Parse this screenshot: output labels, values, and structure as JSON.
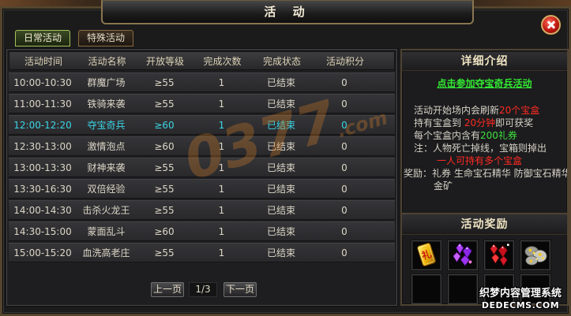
{
  "window": {
    "title": "活 动"
  },
  "tabs": [
    {
      "label": "日常活动",
      "active": true
    },
    {
      "label": "特殊活动",
      "active": false
    }
  ],
  "table": {
    "columns": [
      "活动时间",
      "活动名称",
      "开放等级",
      "完成次数",
      "完成状态",
      "活动积分"
    ],
    "rows": [
      {
        "time": "10:00-10:30",
        "name": "群魔广场",
        "level": "≥55",
        "count": "1",
        "status": "已结束",
        "points": "0"
      },
      {
        "time": "11:00-11:30",
        "name": "铁骑来袭",
        "level": "≥55",
        "count": "1",
        "status": "已结束",
        "points": "0"
      },
      {
        "time": "12:00-12:20",
        "name": "夺宝奇兵",
        "level": "≥60",
        "count": "1",
        "status": "已结束",
        "points": "0",
        "selected": true
      },
      {
        "time": "12:30-13:00",
        "name": "激情泡点",
        "level": "≥60",
        "count": "1",
        "status": "已结束",
        "points": "0"
      },
      {
        "time": "13:00-13:30",
        "name": "财神来袭",
        "level": "≥55",
        "count": "1",
        "status": "已结束",
        "points": "0"
      },
      {
        "time": "13:30-16:30",
        "name": "双倍经验",
        "level": "≥55",
        "count": "1",
        "status": "已结束",
        "points": "0"
      },
      {
        "time": "14:00-14:30",
        "name": "击杀火龙王",
        "level": "≥55",
        "count": "1",
        "status": "已结束",
        "points": "0"
      },
      {
        "time": "14:30-15:00",
        "name": "蒙面乱斗",
        "level": "≥60",
        "count": "1",
        "status": "已结束",
        "points": "0"
      },
      {
        "time": "15:00-15:20",
        "name": "血洗高老庄",
        "level": "≥55",
        "count": "1",
        "status": "已结束",
        "points": "0"
      }
    ]
  },
  "pagination": {
    "prev_label": "上一页",
    "page": "1/3",
    "next_label": "下一页"
  },
  "detail": {
    "heading": "详细介绍",
    "join_link": "点击参加夺宝奇兵活动",
    "lines": [
      [
        {
          "text": "活动开始场内会刷新"
        },
        {
          "text": "20个宝盒",
          "tone": "red"
        }
      ],
      [
        {
          "text": "持有宝盒到 "
        },
        {
          "text": "20分钟",
          "tone": "red"
        },
        {
          "text": "即可获奖"
        }
      ],
      [
        {
          "text": "每个宝盒内含有"
        },
        {
          "text": "200礼券",
          "tone": "green"
        }
      ],
      [
        {
          "text": "注：人物死亡掉线，宝箱则掉出"
        }
      ],
      [
        {
          "text": "一人可持有多个宝盒",
          "tone": "red"
        }
      ],
      [
        {
          "text": "奖励：礼券 生命宝石精华 防御宝石精华"
        }
      ],
      [
        {
          "text": "金矿"
        }
      ]
    ]
  },
  "rewards": {
    "heading": "活动奖励",
    "items": [
      {
        "icon": "gift-coupon-icon",
        "glyph": "礼"
      },
      {
        "icon": "purple-gem-icon"
      },
      {
        "icon": "red-gem-icon"
      },
      {
        "icon": "gold-ore-icon"
      }
    ]
  },
  "watermarks": {
    "center_main": "0377",
    "center_suffix": ".com",
    "corner_line1": "织梦内容管理系统",
    "corner_line2": "DEDECMS.COM"
  },
  "colors": {
    "selected_row_text": "#3ad6e6",
    "red_text": "#ff2a22",
    "green_text": "#3ee03e",
    "link": "#33ea33",
    "active_tab_border": "#a4c25a"
  }
}
